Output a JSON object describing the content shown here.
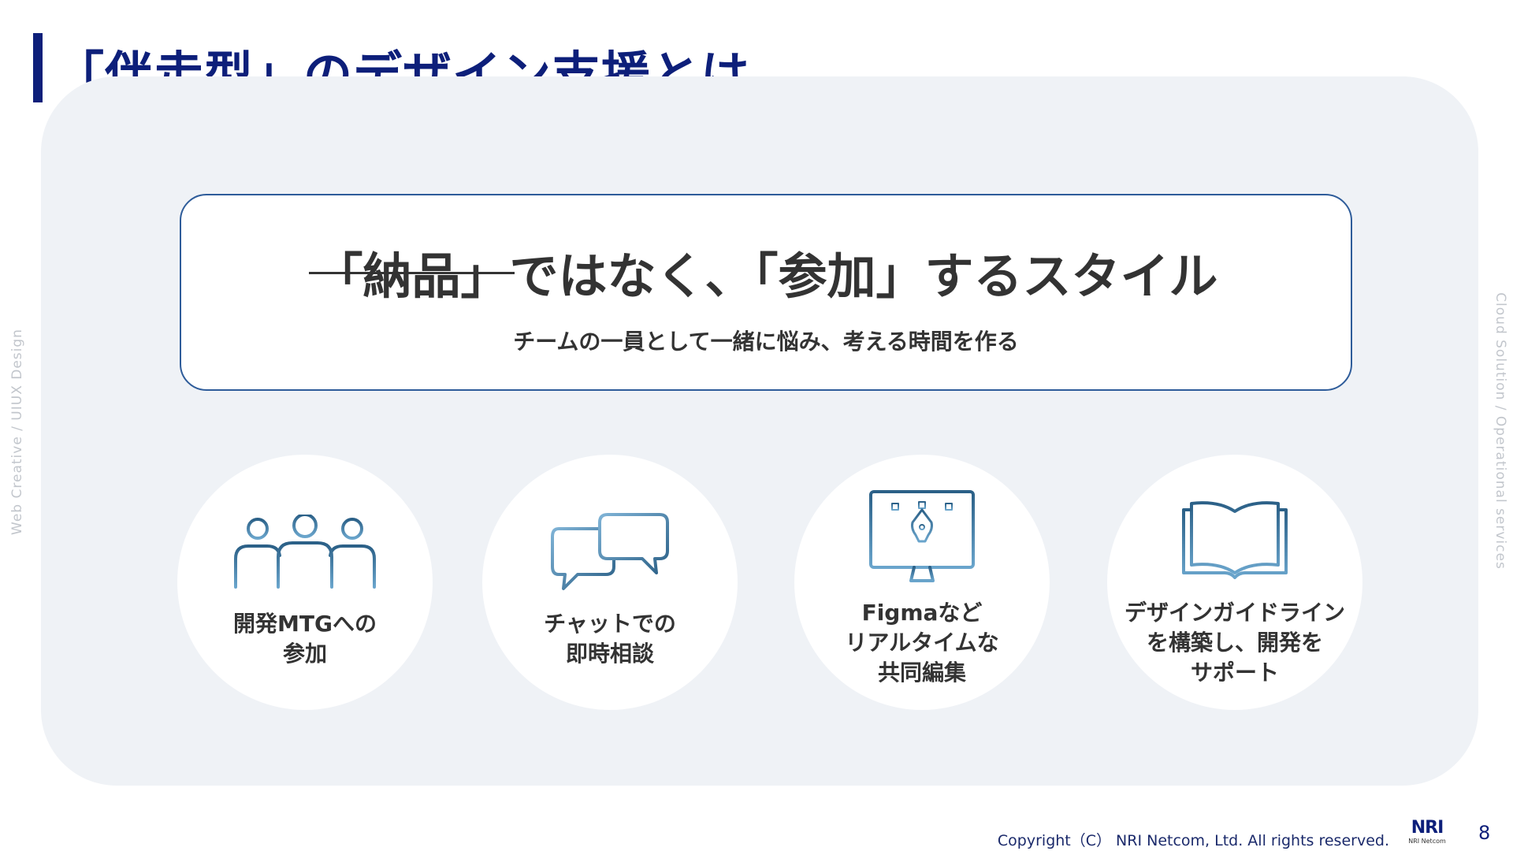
{
  "slide": {
    "title": "「伴走型」のデザイン支援とは",
    "lead": {
      "struck_text": "「納品」",
      "main_text": "ではなく、「参加」するスタイル",
      "subtitle": "チームの一員として一緒に悩み、考える時間を作る"
    },
    "cards": [
      {
        "icon": "team-icon",
        "lines": [
          "開発MTGへの",
          "参加"
        ]
      },
      {
        "icon": "chat-icon",
        "lines": [
          "チャットでの",
          "即時相談"
        ]
      },
      {
        "icon": "monitor-pen-icon",
        "lines": [
          "Figmaなど",
          "リアルタイムな",
          "共同編集"
        ]
      },
      {
        "icon": "book-icon",
        "lines": [
          "デザインガイドライン",
          "を構築し、開発を",
          "サポート"
        ]
      }
    ],
    "side_left": "Web Creative  /  UIUX Design",
    "side_right": "Cloud Solution  /  Operational services",
    "footer": {
      "copyright": "Copyright（C） NRI Netcom, Ltd. All rights reserved.",
      "logo_mark": "NRI",
      "logo_sub": "NRI Netcom",
      "page": "8"
    },
    "colors": {
      "title": "#0d1f7a",
      "panel_bg": "#eff2f6",
      "box_border": "#2e5c9a",
      "icon_gradient_start": "#7fb3d6",
      "icon_gradient_end": "#2b6087"
    }
  }
}
